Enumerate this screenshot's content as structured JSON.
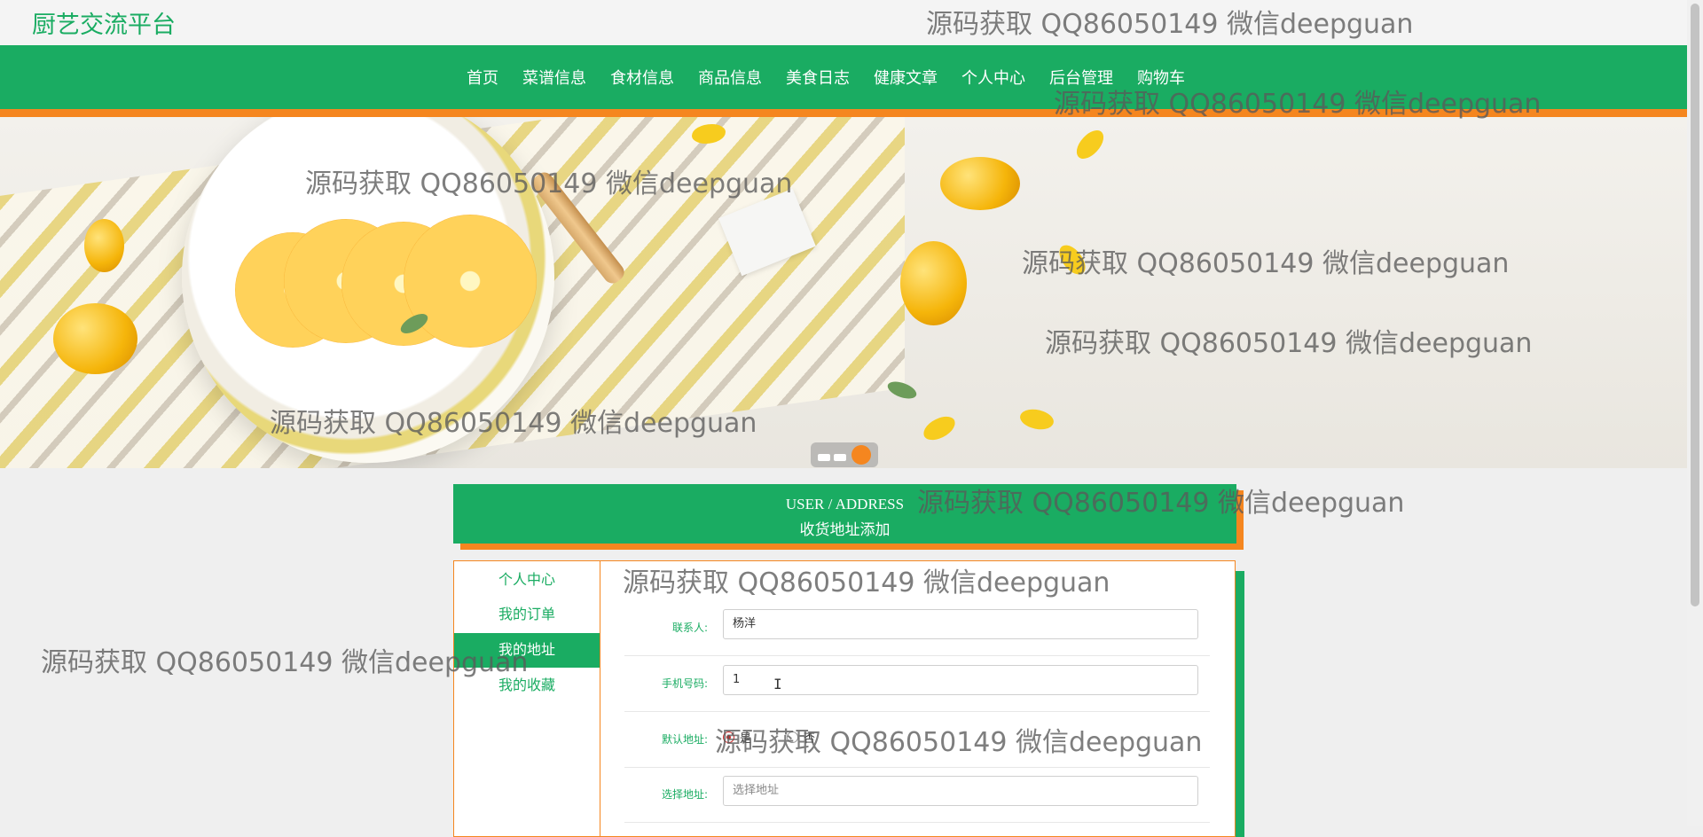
{
  "site": {
    "title": "厨艺交流平台"
  },
  "nav": {
    "items": [
      "首页",
      "菜谱信息",
      "食材信息",
      "商品信息",
      "美食日志",
      "健康文章",
      "个人中心",
      "后台管理",
      "购物车"
    ]
  },
  "banner": {
    "slide_count": 3,
    "active_slide": 3
  },
  "section": {
    "title_en": "USER / ADDRESS",
    "title_zh": "收货地址添加"
  },
  "sidebar": {
    "items": [
      {
        "label": "个人中心",
        "active": false
      },
      {
        "label": "我的订单",
        "active": false
      },
      {
        "label": "我的地址",
        "active": true
      },
      {
        "label": "我的收藏",
        "active": false
      }
    ]
  },
  "form": {
    "contact": {
      "label": "联系人:",
      "value": "杨洋"
    },
    "phone": {
      "label": "手机号码:",
      "value": "1"
    },
    "default_address": {
      "label": "默认地址:",
      "option_yes": "是",
      "option_no": "否",
      "selected": "是"
    },
    "address": {
      "label": "选择地址:",
      "placeholder": "选择地址"
    }
  },
  "watermark": {
    "text": "源码获取 QQ86050149 微信deepguan"
  },
  "colors": {
    "primary": "#1aac62",
    "accent": "#f5861f"
  }
}
